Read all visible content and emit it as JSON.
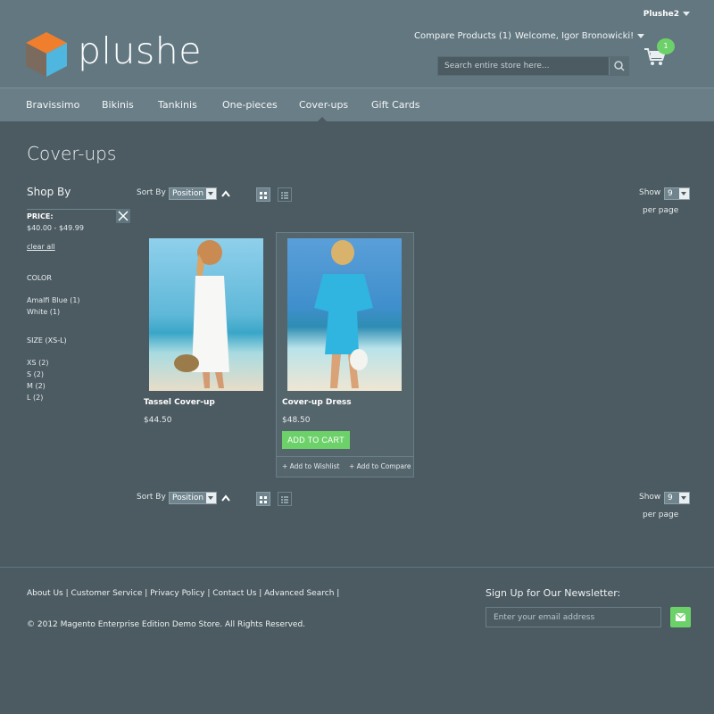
{
  "header": {
    "logo_text": "plushe",
    "store_switch": "Plushe2",
    "compare_link": "Compare Products (1)",
    "welcome": "Welcome, Igor Bronowicki!",
    "search_placeholder": "Search entire store here...",
    "cart_count": "1"
  },
  "nav": {
    "items": [
      "Bravissimo",
      "Bikinis",
      "Tankinis",
      "One-pieces",
      "Cover-ups",
      "Gift Cards"
    ],
    "active": "Cover-ups"
  },
  "page": {
    "title": "Cover-ups"
  },
  "sidebar": {
    "title": "Shop By",
    "price_label": "PRICE:",
    "price_range": "$40.00 - $49.99",
    "clear_all": "clear all",
    "color_title": "COLOR",
    "colors": [
      "Amalfi Blue (1)",
      "White (1)"
    ],
    "size_title": "SIZE (XS-L)",
    "sizes": [
      "XS (2)",
      "S (2)",
      "M (2)",
      "L (2)"
    ]
  },
  "toolbar": {
    "sort_by": "Sort By",
    "sort_value": "Position",
    "show": "Show",
    "show_value": "9",
    "per_page": "per page"
  },
  "products": [
    {
      "name": "Tassel Cover-up",
      "price": "$44.50"
    },
    {
      "name": "Cover-up Dress",
      "price": "$48.50",
      "add_to_cart": "ADD TO CART",
      "wishlist": "+ Add to Wishlist",
      "compare": "+ Add to Compare"
    }
  ],
  "footer": {
    "links": [
      "About Us",
      "Customer Service",
      "Privacy Policy",
      "Contact Us",
      "Advanced Search"
    ],
    "copyright": "© 2012 Magento Enterprise Edition Demo Store. All Rights Reserved.",
    "newsletter_label": "Sign Up for Our Newsletter:",
    "newsletter_placeholder": "Enter your email address"
  },
  "colors": {
    "background": "#4c5b62",
    "header": "#627780",
    "nav": "#6a7e87",
    "accent_green": "#6dd16a",
    "logo_orange": "#f07f2d",
    "logo_blue": "#4fb6df"
  }
}
